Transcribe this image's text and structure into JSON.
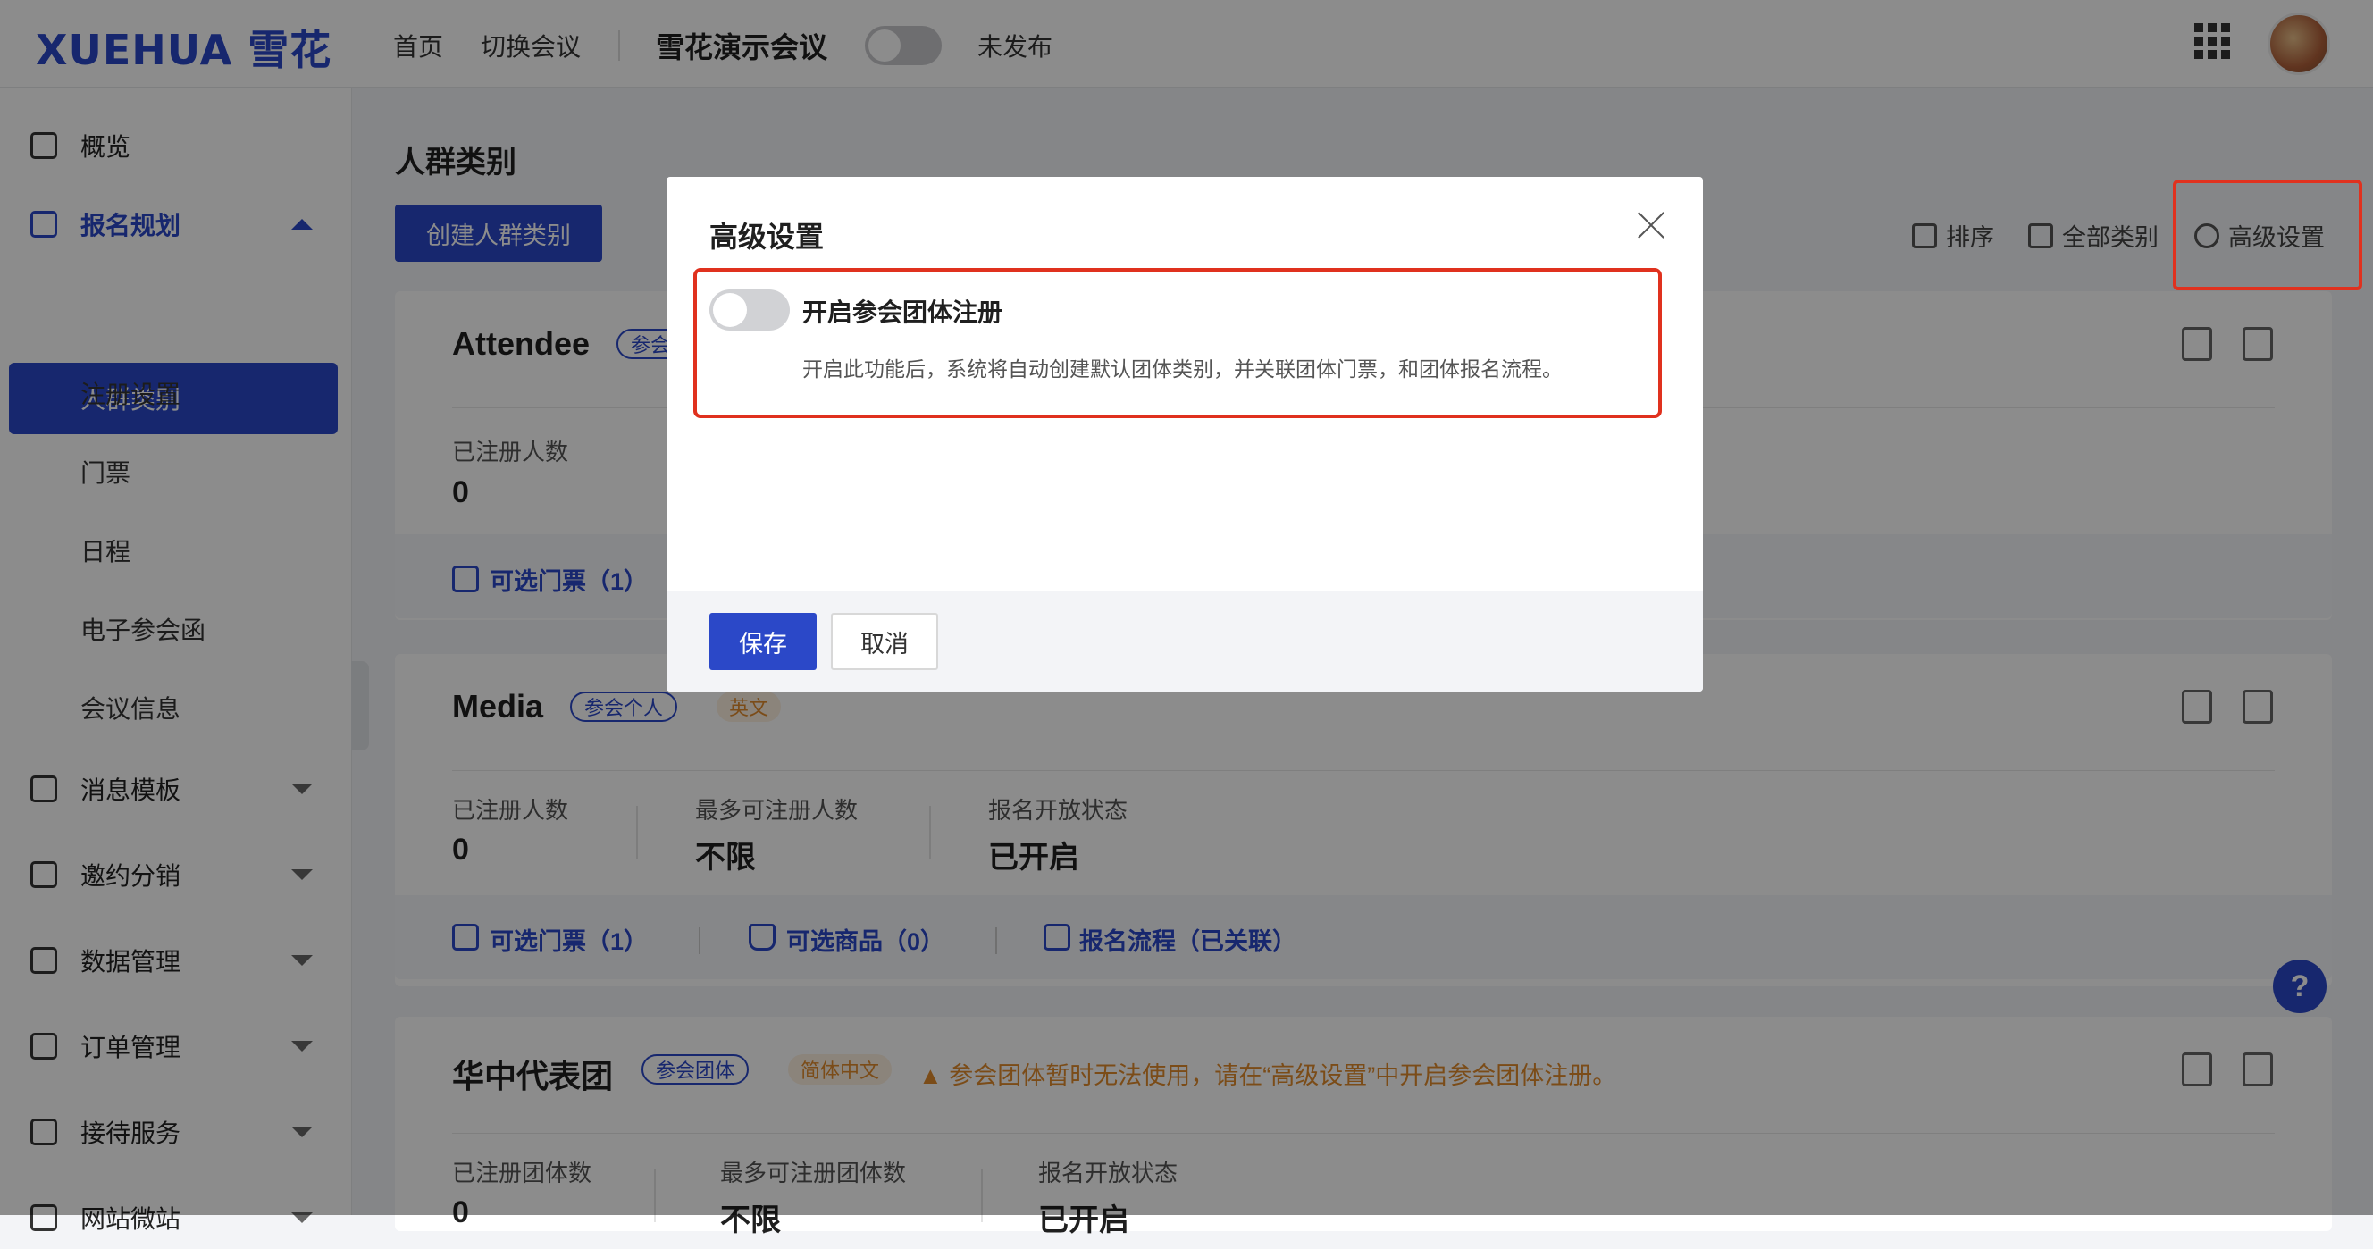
{
  "header": {
    "logo": "XUEHUA 雪花",
    "nav_home": "首页",
    "nav_switch": "切换会议",
    "conference_name": "雪花演示会议",
    "publish_status": "未发布"
  },
  "sidebar": {
    "overview": "概览",
    "registration": "报名规划",
    "sub_items": [
      "人群类别",
      "注册设置",
      "门票",
      "日程",
      "电子参会函",
      "会议信息"
    ],
    "messages": "消息模板",
    "invite": "邀约分销",
    "data": "数据管理",
    "orders": "订单管理",
    "reception": "接待服务",
    "website": "网站微站"
  },
  "main": {
    "title": "人群类别",
    "create_button": "创建人群类别",
    "sort": "排序",
    "all_categories": "全部类别",
    "advanced": "高级设置"
  },
  "cards": [
    {
      "name": "Attendee",
      "tag": "参会",
      "stat1_label": "已注册人数",
      "stat1_value": "0",
      "link1": "可选门票（1）"
    },
    {
      "name": "Media",
      "tag": "参会个人",
      "lang": "英文",
      "stat1_label": "已注册人数",
      "stat1_value": "0",
      "stat2_label": "最多可注册人数",
      "stat2_value": "不限",
      "stat3_label": "报名开放状态",
      "stat3_value": "已开启",
      "link1": "可选门票（1）",
      "link2": "可选商品（0）",
      "link3": "报名流程（已关联）"
    },
    {
      "name": "华中代表团",
      "tag": "参会团体",
      "lang": "简体中文",
      "warning": "参会团体暂时无法使用，请在“高级设置”中开启参会团体注册。",
      "stat1_label": "已注册团体数",
      "stat1_value": "0",
      "stat2_label": "最多可注册团体数",
      "stat2_value": "不限",
      "stat3_label": "报名开放状态",
      "stat3_value": "已开启"
    }
  ],
  "modal": {
    "title": "高级设置",
    "option_title": "开启参会团体注册",
    "option_desc": "开启此功能后，系统将自动创建默认团体类别，并关联团体门票，和团体报名流程。",
    "save": "保存",
    "cancel": "取消"
  },
  "help": "?"
}
